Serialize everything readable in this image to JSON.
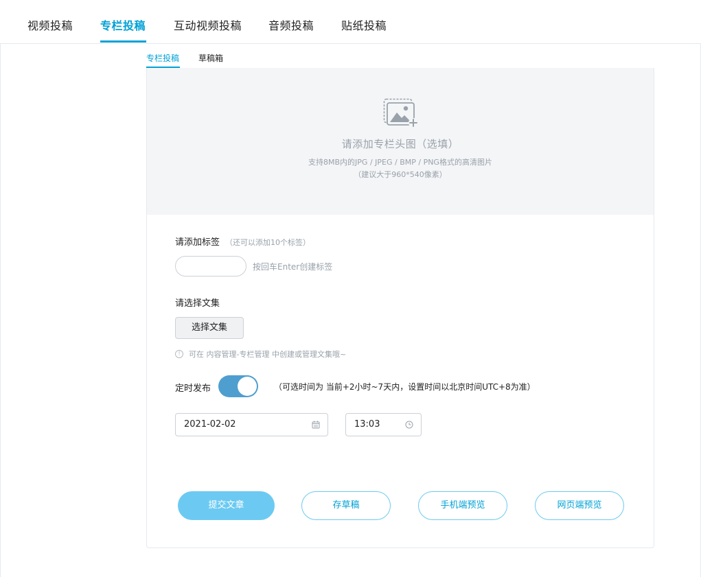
{
  "top_tabs": [
    {
      "label": "视频投稿",
      "active": false
    },
    {
      "label": "专栏投稿",
      "active": true
    },
    {
      "label": "互动视频投稿",
      "active": false
    },
    {
      "label": "音频投稿",
      "active": false
    },
    {
      "label": "贴纸投稿",
      "active": false
    }
  ],
  "sub_tabs": [
    {
      "label": "专栏投稿",
      "active": true
    },
    {
      "label": "草稿箱",
      "active": false
    }
  ],
  "cover": {
    "title": "请添加专栏头图（选填）",
    "desc1": "支持8MB内的JPG / JPEG / BMP / PNG格式的高清图片",
    "desc2": "（建议大于960*540像素）",
    "icon": "add-image-icon"
  },
  "tags": {
    "label": "请添加标签",
    "hint": "（还可以添加10个标签）",
    "input_value": "",
    "input_hint": "按回车Enter创建标签"
  },
  "collection": {
    "label": "请选择文集",
    "button_label": "选择文集",
    "info_icon": "info-icon",
    "info_text": "可在 内容管理-专栏管理 中创建或管理文集哦~"
  },
  "schedule": {
    "label": "定时发布",
    "enabled": true,
    "hint": "（可选时间为 当前+2小时~7天内，设置时间以北京时间UTC+8为准）",
    "date_value": "2021-02-02",
    "time_value": "13:03",
    "date_icon": "calendar-icon",
    "time_icon": "clock-icon"
  },
  "actions": {
    "submit": "提交文章",
    "save_draft": "存草稿",
    "mobile_preview": "手机端预览",
    "web_preview": "网页端预览"
  },
  "colors": {
    "accent": "#00a1d6",
    "primary_button": "#6ccaf2",
    "toggle_on": "#4e9fcf",
    "muted_text": "#99a2aa",
    "cover_bg": "#f4f5f7"
  }
}
